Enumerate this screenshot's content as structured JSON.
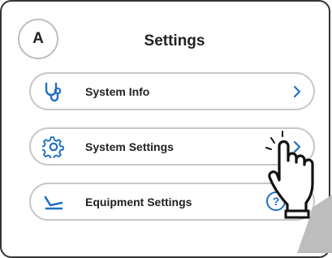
{
  "header": {
    "avatar_letter": "A",
    "title": "Settings"
  },
  "menu": {
    "items": [
      {
        "label": "System Info",
        "icon": "stethoscope-icon",
        "action_icon": "chevron-right-icon"
      },
      {
        "label": "System Settings",
        "icon": "gear-icon",
        "action_icon": "chevron-right-icon"
      },
      {
        "label": "Equipment Settings",
        "icon": "chair-icon",
        "action_icon": "help-icon",
        "help_symbol": "?"
      }
    ]
  },
  "colors": {
    "accent": "#1f6fc4",
    "border": "#c7c7c7",
    "text": "#222222"
  },
  "overlay": {
    "icon": "pointing-hand-icon"
  }
}
